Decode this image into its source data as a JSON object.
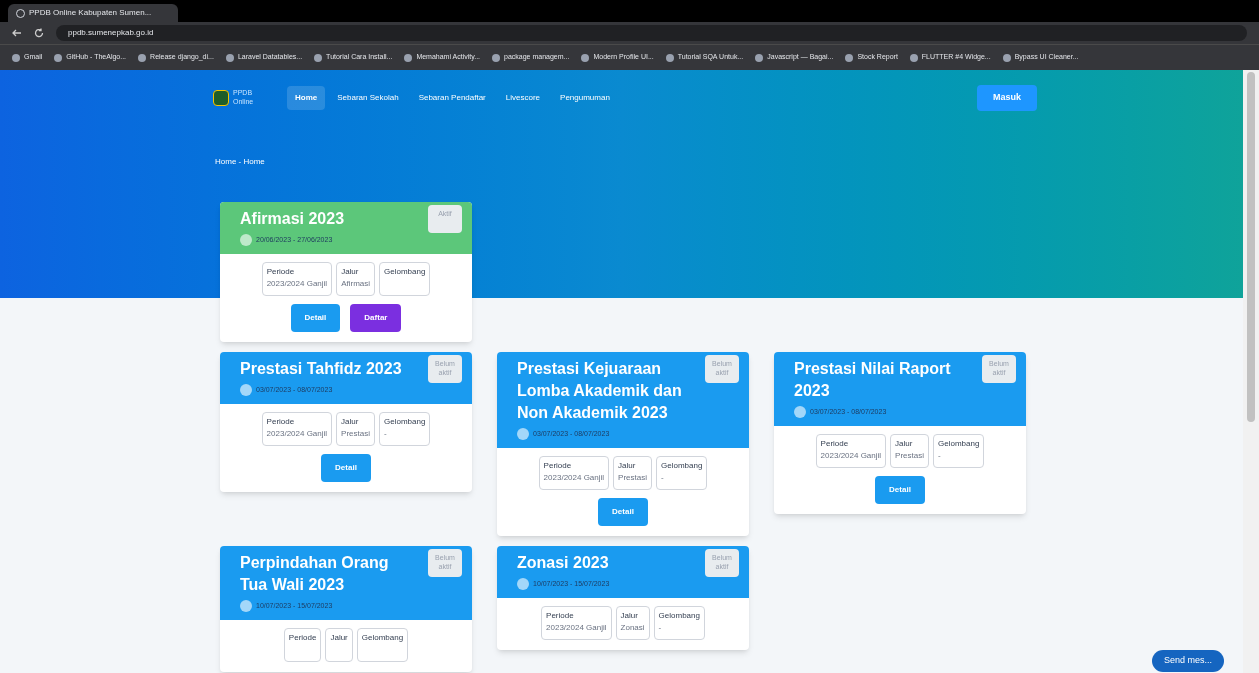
{
  "browser": {
    "tab_title": "PPDB Online Kabupaten Sumen...",
    "address": "ppdb.sumenepkab.go.id",
    "bookmarks": [
      "Gmail",
      "GitHub - TheAlgo...",
      "Release django_di...",
      "Laravel Datatables...",
      "Tutorial Cara Install...",
      "Memahami Activity...",
      "package managem...",
      "Modern Profile UI...",
      "Tutorial SQA Untuk...",
      "Javascript — Bagai...",
      "Stock Report",
      "FLUTTER #4 Widge...",
      "Bypass UI Cleaner..."
    ]
  },
  "navbar": {
    "logo_text": "PPDB Online",
    "items": [
      {
        "label": "Home",
        "selected": true
      },
      {
        "label": "Sebaran Sekolah",
        "selected": false
      },
      {
        "label": "Sebaran Pendaftar",
        "selected": false
      },
      {
        "label": "Livescore",
        "selected": false
      },
      {
        "label": "Pengumuman",
        "selected": false
      }
    ],
    "login_button": "Masuk"
  },
  "breadcrumb": "Home - Home",
  "card_rows": [
    {
      "cards": [
        {
          "title": "Afirmasi 2023",
          "color": "#5cc77a",
          "badge": "Aktif",
          "dates": "20/06/2023 - 27/06/2023",
          "info": [
            {
              "label": "Periode",
              "value": "2023/2024 Ganjil"
            },
            {
              "label": "Jalur",
              "value": "Afirmasi"
            },
            {
              "label": "Gelombang"
            }
          ],
          "buttons": [
            {
              "label": "Detail",
              "kind": "detail"
            },
            {
              "label": "Daftar",
              "kind": "register"
            }
          ]
        }
      ]
    },
    {
      "cards": [
        {
          "title": "Prestasi Tahfidz 2023",
          "color": "#1a9bf0",
          "badge": "Belum aktif",
          "dates": "03/07/2023 - 08/07/2023",
          "info": [
            {
              "label": "Periode",
              "value": "2023/2024 Ganjil"
            },
            {
              "label": "Jalur",
              "value": "Prestasi"
            },
            {
              "label": "Gelombang",
              "value": "-"
            }
          ],
          "buttons": [
            {
              "label": "Detail",
              "kind": "detail"
            }
          ]
        },
        {
          "title": "Prestasi Kejuaraan Lomba Akademik dan Non Akademik 2023",
          "color": "#1a9bf0",
          "badge": "Belum aktif",
          "dates": "03/07/2023 - 08/07/2023",
          "info": [
            {
              "label": "Periode",
              "value": "2023/2024 Ganjil"
            },
            {
              "label": "Jalur",
              "value": "Prestasi"
            },
            {
              "label": "Gelombang",
              "value": "-"
            }
          ],
          "buttons": [
            {
              "label": "Detail",
              "kind": "detail"
            }
          ]
        },
        {
          "title": "Prestasi Nilai Raport 2023",
          "color": "#1a9bf0",
          "badge": "Belum aktif",
          "dates": "03/07/2023 - 08/07/2023",
          "info": [
            {
              "label": "Periode",
              "value": "2023/2024 Ganjil"
            },
            {
              "label": "Jalur",
              "value": "Prestasi"
            },
            {
              "label": "Gelombang",
              "value": "-"
            }
          ],
          "buttons": [
            {
              "label": "Detail",
              "kind": "detail"
            }
          ]
        }
      ]
    },
    {
      "cards": [
        {
          "title": "Perpindahan Orang Tua Wali 2023",
          "color": "#1a9bf0",
          "badge": "Belum aktif",
          "dates": "10/07/2023 - 15/07/2023",
          "info": [
            {
              "label": "Periode"
            },
            {
              "label": "Jalur"
            },
            {
              "label": "Gelombang"
            }
          ]
        },
        {
          "title": "Zonasi 2023",
          "color": "#1a9bf0",
          "badge": "Belum aktif",
          "dates": "10/07/2023 - 15/07/2023",
          "info": [
            {
              "label": "Periode",
              "value": "2023/2024 Ganjil"
            },
            {
              "label": "Jalur",
              "value": "Zonasi"
            },
            {
              "label": "Gelombang",
              "value": "-"
            }
          ]
        }
      ]
    }
  ],
  "chat_button": "Send mes..."
}
